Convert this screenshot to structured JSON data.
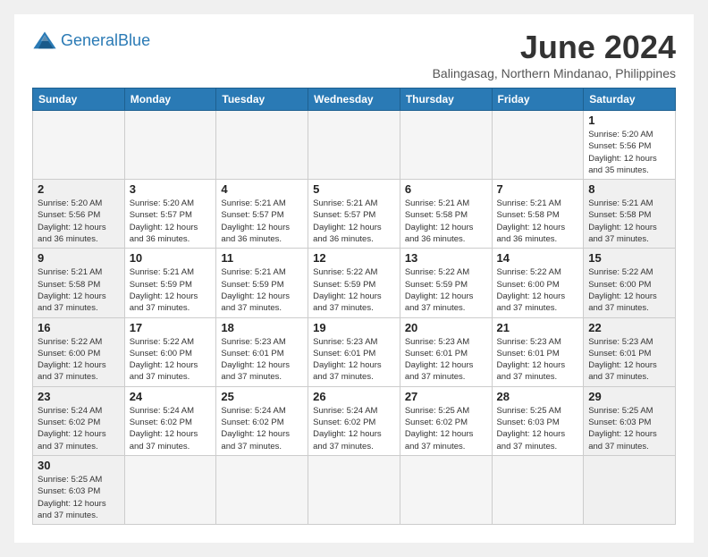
{
  "header": {
    "logo_general": "General",
    "logo_blue": "Blue",
    "month_title": "June 2024",
    "location": "Balingasag, Northern Mindanao, Philippines"
  },
  "weekdays": [
    "Sunday",
    "Monday",
    "Tuesday",
    "Wednesday",
    "Thursday",
    "Friday",
    "Saturday"
  ],
  "days": {
    "d1": {
      "num": "1",
      "info": "Sunrise: 5:20 AM\nSunset: 5:56 PM\nDaylight: 12 hours\nand 35 minutes."
    },
    "d2": {
      "num": "2",
      "info": "Sunrise: 5:20 AM\nSunset: 5:56 PM\nDaylight: 12 hours\nand 36 minutes."
    },
    "d3": {
      "num": "3",
      "info": "Sunrise: 5:20 AM\nSunset: 5:57 PM\nDaylight: 12 hours\nand 36 minutes."
    },
    "d4": {
      "num": "4",
      "info": "Sunrise: 5:21 AM\nSunset: 5:57 PM\nDaylight: 12 hours\nand 36 minutes."
    },
    "d5": {
      "num": "5",
      "info": "Sunrise: 5:21 AM\nSunset: 5:57 PM\nDaylight: 12 hours\nand 36 minutes."
    },
    "d6": {
      "num": "6",
      "info": "Sunrise: 5:21 AM\nSunset: 5:58 PM\nDaylight: 12 hours\nand 36 minutes."
    },
    "d7": {
      "num": "7",
      "info": "Sunrise: 5:21 AM\nSunset: 5:58 PM\nDaylight: 12 hours\nand 36 minutes."
    },
    "d8": {
      "num": "8",
      "info": "Sunrise: 5:21 AM\nSunset: 5:58 PM\nDaylight: 12 hours\nand 37 minutes."
    },
    "d9": {
      "num": "9",
      "info": "Sunrise: 5:21 AM\nSunset: 5:58 PM\nDaylight: 12 hours\nand 37 minutes."
    },
    "d10": {
      "num": "10",
      "info": "Sunrise: 5:21 AM\nSunset: 5:59 PM\nDaylight: 12 hours\nand 37 minutes."
    },
    "d11": {
      "num": "11",
      "info": "Sunrise: 5:21 AM\nSunset: 5:59 PM\nDaylight: 12 hours\nand 37 minutes."
    },
    "d12": {
      "num": "12",
      "info": "Sunrise: 5:22 AM\nSunset: 5:59 PM\nDaylight: 12 hours\nand 37 minutes."
    },
    "d13": {
      "num": "13",
      "info": "Sunrise: 5:22 AM\nSunset: 5:59 PM\nDaylight: 12 hours\nand 37 minutes."
    },
    "d14": {
      "num": "14",
      "info": "Sunrise: 5:22 AM\nSunset: 6:00 PM\nDaylight: 12 hours\nand 37 minutes."
    },
    "d15": {
      "num": "15",
      "info": "Sunrise: 5:22 AM\nSunset: 6:00 PM\nDaylight: 12 hours\nand 37 minutes."
    },
    "d16": {
      "num": "16",
      "info": "Sunrise: 5:22 AM\nSunset: 6:00 PM\nDaylight: 12 hours\nand 37 minutes."
    },
    "d17": {
      "num": "17",
      "info": "Sunrise: 5:22 AM\nSunset: 6:00 PM\nDaylight: 12 hours\nand 37 minutes."
    },
    "d18": {
      "num": "18",
      "info": "Sunrise: 5:23 AM\nSunset: 6:01 PM\nDaylight: 12 hours\nand 37 minutes."
    },
    "d19": {
      "num": "19",
      "info": "Sunrise: 5:23 AM\nSunset: 6:01 PM\nDaylight: 12 hours\nand 37 minutes."
    },
    "d20": {
      "num": "20",
      "info": "Sunrise: 5:23 AM\nSunset: 6:01 PM\nDaylight: 12 hours\nand 37 minutes."
    },
    "d21": {
      "num": "21",
      "info": "Sunrise: 5:23 AM\nSunset: 6:01 PM\nDaylight: 12 hours\nand 37 minutes."
    },
    "d22": {
      "num": "22",
      "info": "Sunrise: 5:23 AM\nSunset: 6:01 PM\nDaylight: 12 hours\nand 37 minutes."
    },
    "d23": {
      "num": "23",
      "info": "Sunrise: 5:24 AM\nSunset: 6:02 PM\nDaylight: 12 hours\nand 37 minutes."
    },
    "d24": {
      "num": "24",
      "info": "Sunrise: 5:24 AM\nSunset: 6:02 PM\nDaylight: 12 hours\nand 37 minutes."
    },
    "d25": {
      "num": "25",
      "info": "Sunrise: 5:24 AM\nSunset: 6:02 PM\nDaylight: 12 hours\nand 37 minutes."
    },
    "d26": {
      "num": "26",
      "info": "Sunrise: 5:24 AM\nSunset: 6:02 PM\nDaylight: 12 hours\nand 37 minutes."
    },
    "d27": {
      "num": "27",
      "info": "Sunrise: 5:25 AM\nSunset: 6:02 PM\nDaylight: 12 hours\nand 37 minutes."
    },
    "d28": {
      "num": "28",
      "info": "Sunrise: 5:25 AM\nSunset: 6:03 PM\nDaylight: 12 hours\nand 37 minutes."
    },
    "d29": {
      "num": "29",
      "info": "Sunrise: 5:25 AM\nSunset: 6:03 PM\nDaylight: 12 hours\nand 37 minutes."
    },
    "d30": {
      "num": "30",
      "info": "Sunrise: 5:25 AM\nSunset: 6:03 PM\nDaylight: 12 hours\nand 37 minutes."
    }
  }
}
